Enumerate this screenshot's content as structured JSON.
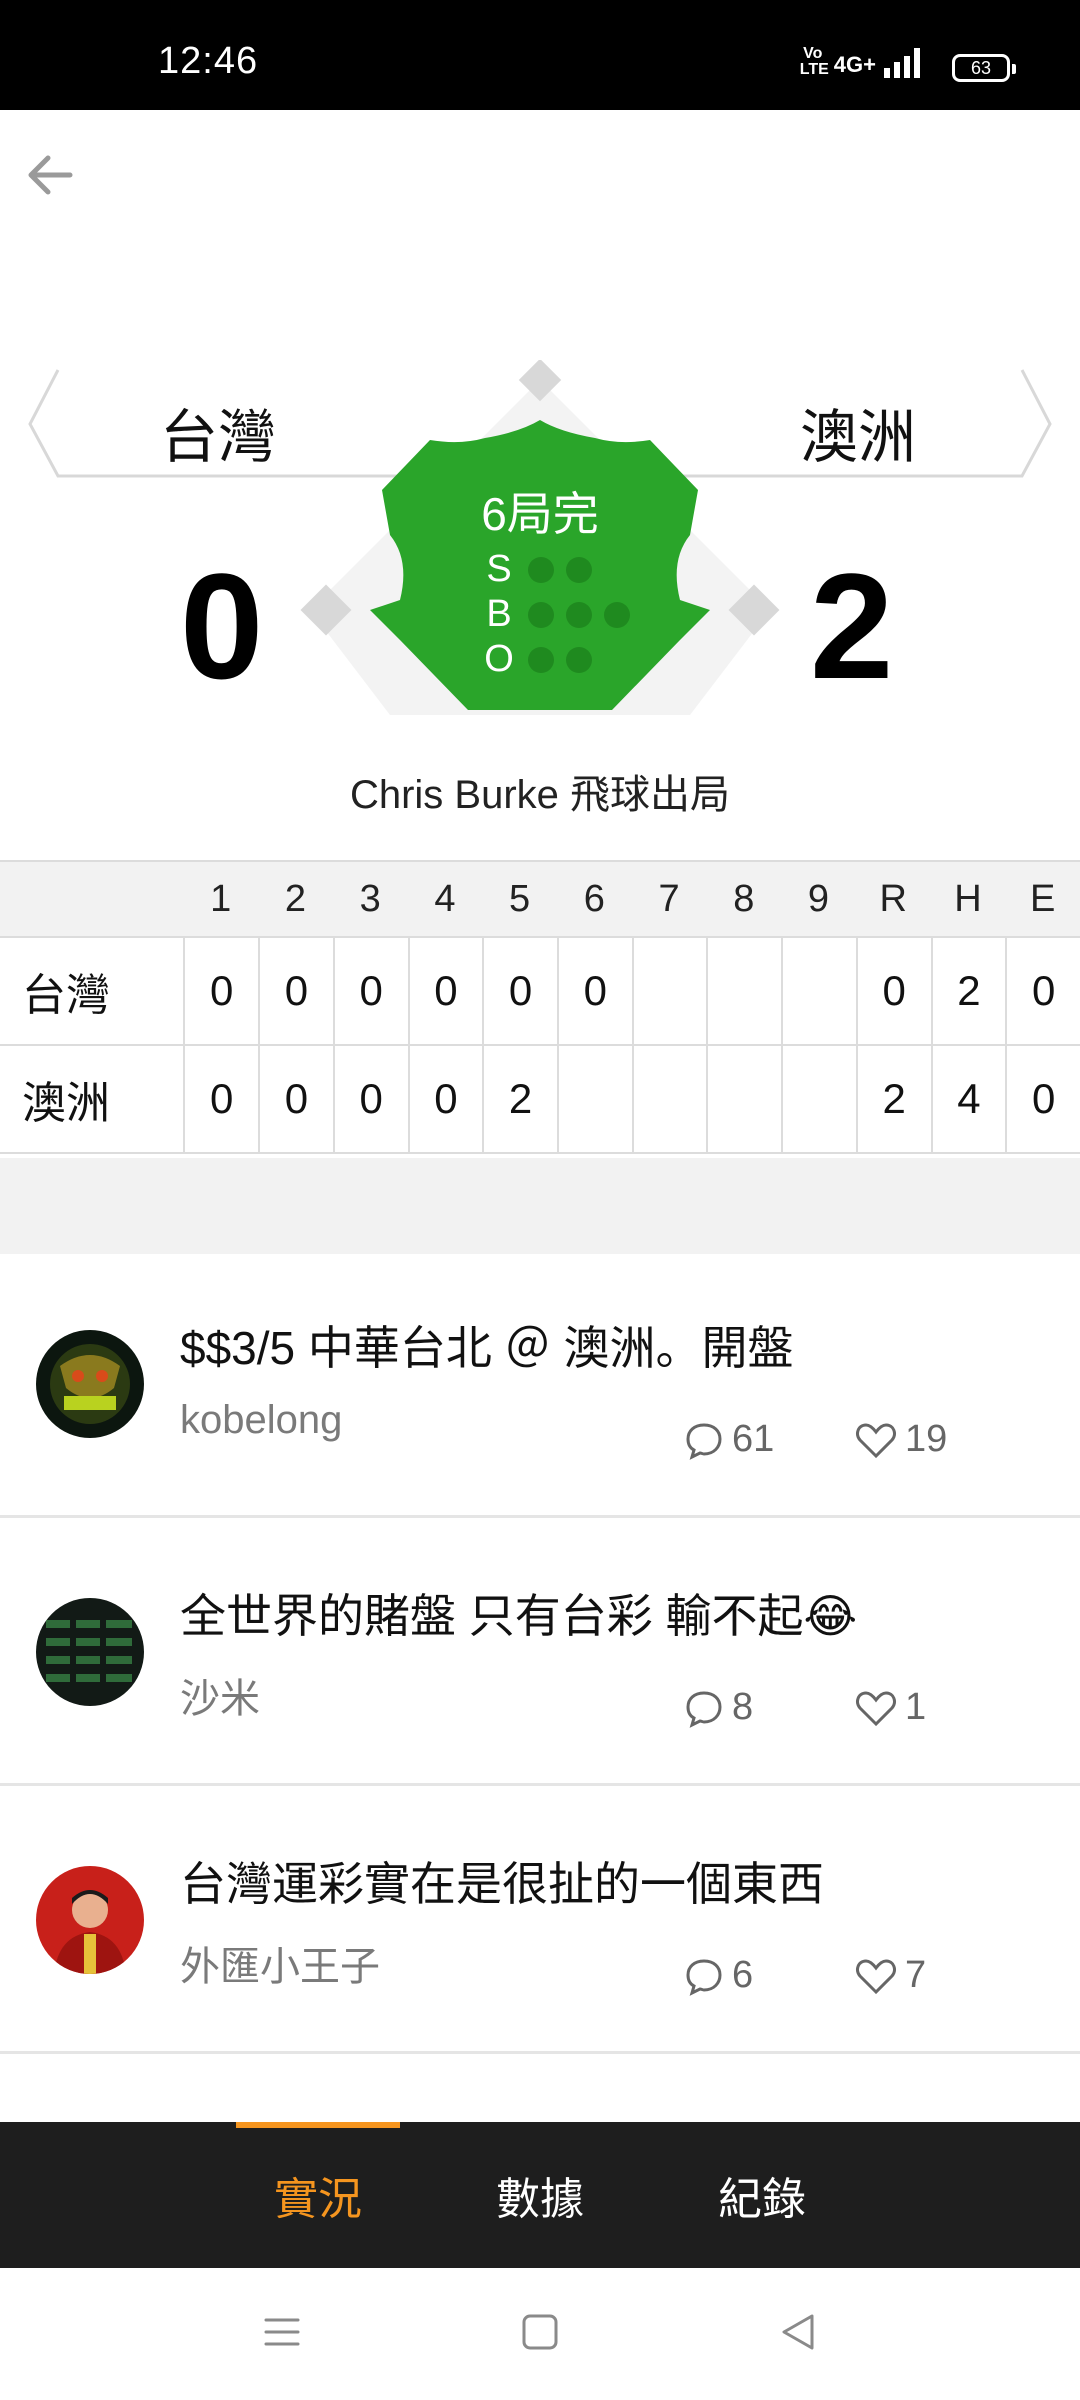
{
  "status_bar": {
    "time": "12:46",
    "network": "4G+",
    "volte": "Vo LTE",
    "battery": "63"
  },
  "game": {
    "home_team": "台灣",
    "away_team": "澳洲",
    "home_score": "0",
    "away_score": "2",
    "inning_status": "6局完",
    "count": {
      "balls_label": "S",
      "strikes_label": "B",
      "outs_label": "O"
    },
    "last_play": "Chris Burke 飛球出局"
  },
  "linescore": {
    "headers": [
      "1",
      "2",
      "3",
      "4",
      "5",
      "6",
      "7",
      "8",
      "9",
      "R",
      "H",
      "E"
    ],
    "rows": [
      {
        "team": "台灣",
        "cells": [
          "0",
          "0",
          "0",
          "0",
          "0",
          "0",
          "",
          "",
          "",
          "0",
          "2",
          "0"
        ]
      },
      {
        "team": "澳洲",
        "cells": [
          "0",
          "0",
          "0",
          "0",
          "2",
          "",
          "",
          "",
          "",
          "2",
          "4",
          "0"
        ]
      }
    ]
  },
  "posts": [
    {
      "title": "$$3/5 中華台北 ＠ 澳洲。開盤",
      "author": "kobelong",
      "comments": "61",
      "likes": "19",
      "avatar_icon": "win-logo-avatar"
    },
    {
      "title": "全世界的賭盤 只有台彩 輸不起😂",
      "author": "沙米",
      "comments": "8",
      "likes": "1",
      "avatar_icon": "odds-table-avatar"
    },
    {
      "title": "台灣運彩實在是很扯的一個東西",
      "author": "外匯小王子",
      "comments": "6",
      "likes": "7",
      "avatar_icon": "person-red-avatar"
    }
  ],
  "tabs": [
    {
      "label": "實況",
      "active": true
    },
    {
      "label": "數據",
      "active": false
    },
    {
      "label": "紀錄",
      "active": false
    }
  ],
  "colors": {
    "field_green": "#2aa52a",
    "accent_orange": "#f5951f",
    "tabbar_bg": "#1e1e1e"
  }
}
